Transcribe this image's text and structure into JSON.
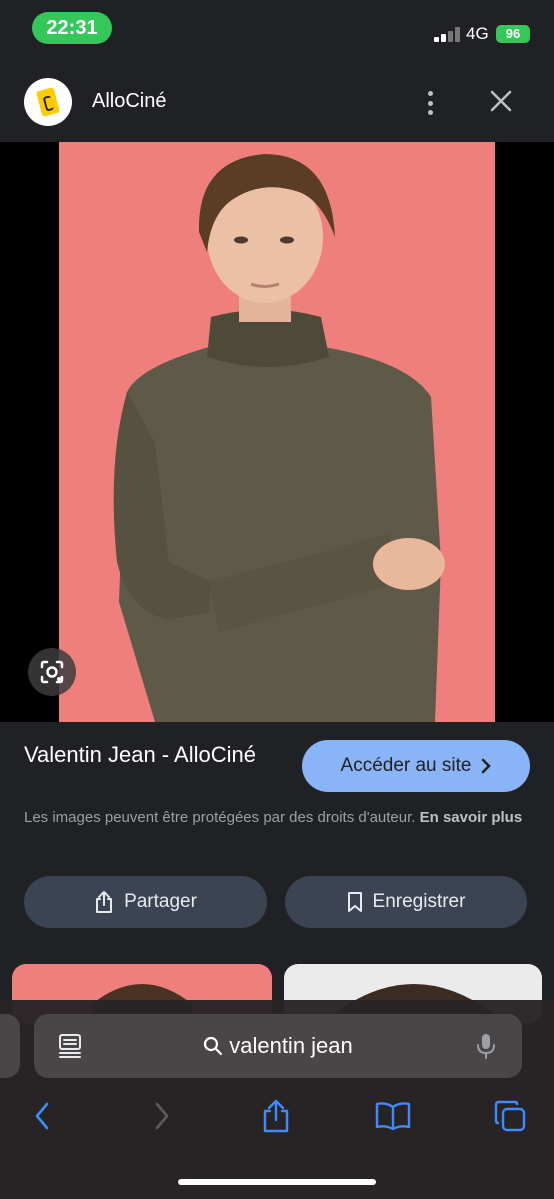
{
  "status_bar": {
    "time": "22:31",
    "network": "4G",
    "battery": "96"
  },
  "header": {
    "site_name": "AlloCiné",
    "logo_icon": "allocine-logo",
    "more_icon": "more-vertical-icon",
    "close_icon": "close-icon"
  },
  "image": {
    "lens_icon": "google-lens-icon"
  },
  "result": {
    "title": "Valentin Jean - AlloCiné",
    "visit_label": "Accéder au site",
    "copyright_text": "Les images peuvent être protégées par des droits d'auteur.",
    "learn_more": "En savoir plus"
  },
  "actions": {
    "share_label": "Partager",
    "save_label": "Enregistrer"
  },
  "search": {
    "query": "valentin jean"
  },
  "colors": {
    "accent": "#8ab4f8",
    "time_pill": "#34c759",
    "photo_bg": "#ef7f7c"
  }
}
